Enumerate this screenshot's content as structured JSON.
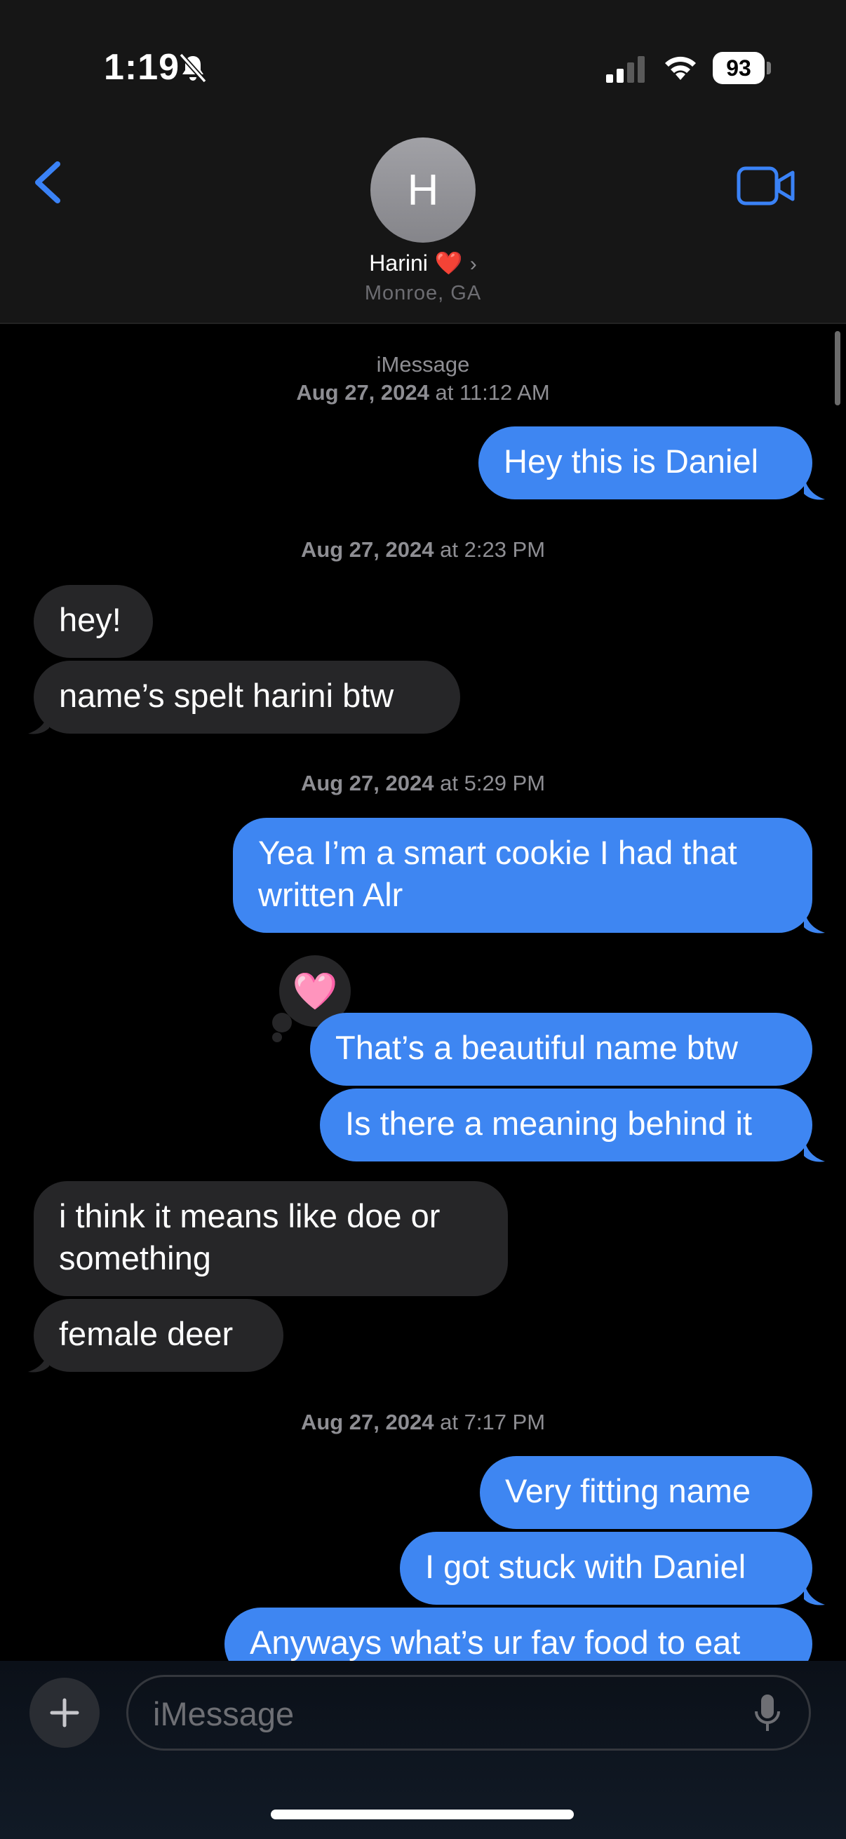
{
  "status_bar": {
    "time": "1:19",
    "battery": "93"
  },
  "contact": {
    "avatar_initial": "H",
    "name": "Harini",
    "heart": "❤️",
    "chevron": "›",
    "location": "Monroe, GA"
  },
  "conversation": {
    "service_label": "iMessage",
    "stamps": [
      {
        "date": "Aug 27, 2024",
        "at": "at",
        "time": "11:12 AM"
      },
      {
        "date": "Aug 27, 2024",
        "at": "at",
        "time": "2:23 PM"
      },
      {
        "date": "Aug 27, 2024",
        "at": "at",
        "time": "5:29 PM"
      },
      {
        "date": "Aug 27, 2024",
        "at": "at",
        "time": "7:17 PM"
      }
    ],
    "messages": [
      {
        "from": "me",
        "text": "Hey this is Daniel"
      },
      {
        "from": "them",
        "text": "hey!"
      },
      {
        "from": "them",
        "text": "name’s spelt harini btw"
      },
      {
        "from": "me",
        "text_line1": "Yea I’m a smart cookie I had that",
        "text_line2": "written Alr"
      },
      {
        "from": "me",
        "text": "That’s a beautiful name btw",
        "reaction": "🩷"
      },
      {
        "from": "me",
        "text": "Is there a meaning behind it"
      },
      {
        "from": "them",
        "text_line1": "i think it means like doe or",
        "text_line2": "something"
      },
      {
        "from": "them",
        "text": "female deer"
      },
      {
        "from": "me",
        "text": "Very fitting name"
      },
      {
        "from": "me",
        "text": "I got stuck with Daniel"
      },
      {
        "from": "me",
        "text": "Anyways what’s ur fav food to eat"
      }
    ]
  },
  "composer": {
    "placeholder": "iMessage"
  },
  "colors": {
    "sent_bubble": "#3e86f2",
    "received_bubble": "#262628",
    "accent": "#3a82f6"
  }
}
